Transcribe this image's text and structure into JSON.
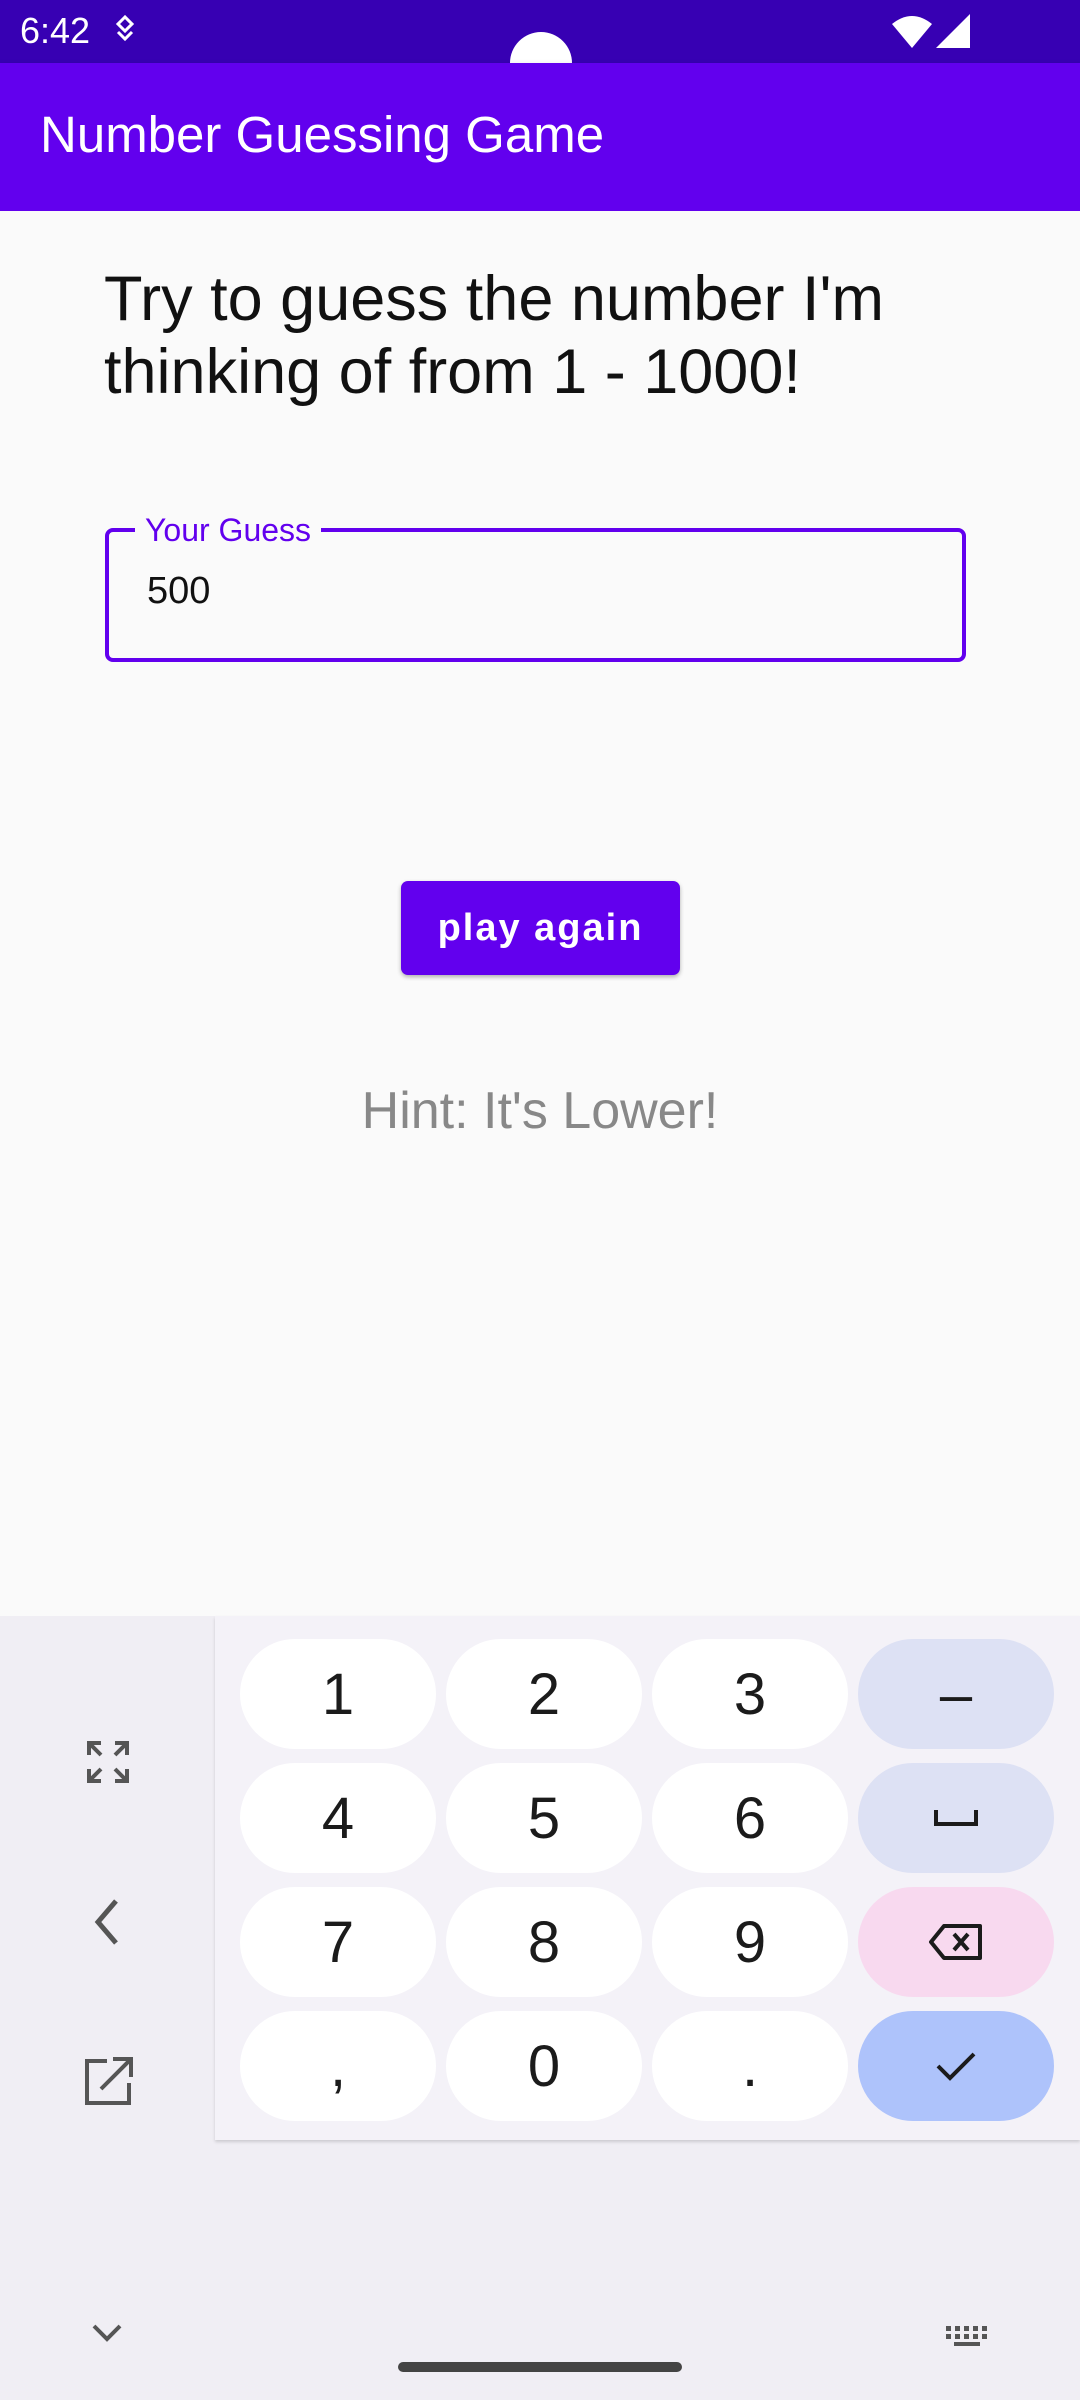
{
  "status_bar": {
    "time": "6:42"
  },
  "app_bar": {
    "title": "Number Guessing Game"
  },
  "main": {
    "instructions": "Try to guess the number I'm thinking of from 1 - 1000!",
    "guess_field": {
      "label": "Your Guess",
      "value": "500"
    },
    "play_again_label": "play again",
    "hint": "Hint: It's Lower!"
  },
  "keyboard": {
    "keys": [
      "1",
      "2",
      "3",
      "–",
      "4",
      "5",
      "6",
      "space",
      "7",
      "8",
      "9",
      "backspace",
      ",",
      "0",
      ".",
      "done"
    ],
    "side_icons": [
      "expand-icon",
      "back-chevron-icon",
      "popout-icon"
    ],
    "bottom_icons": [
      "collapse-icon",
      "keyboard-switch-icon"
    ]
  },
  "colors": {
    "primary": "#6200ee",
    "primary_dark": "#3700b3",
    "hint_text": "#888888"
  }
}
